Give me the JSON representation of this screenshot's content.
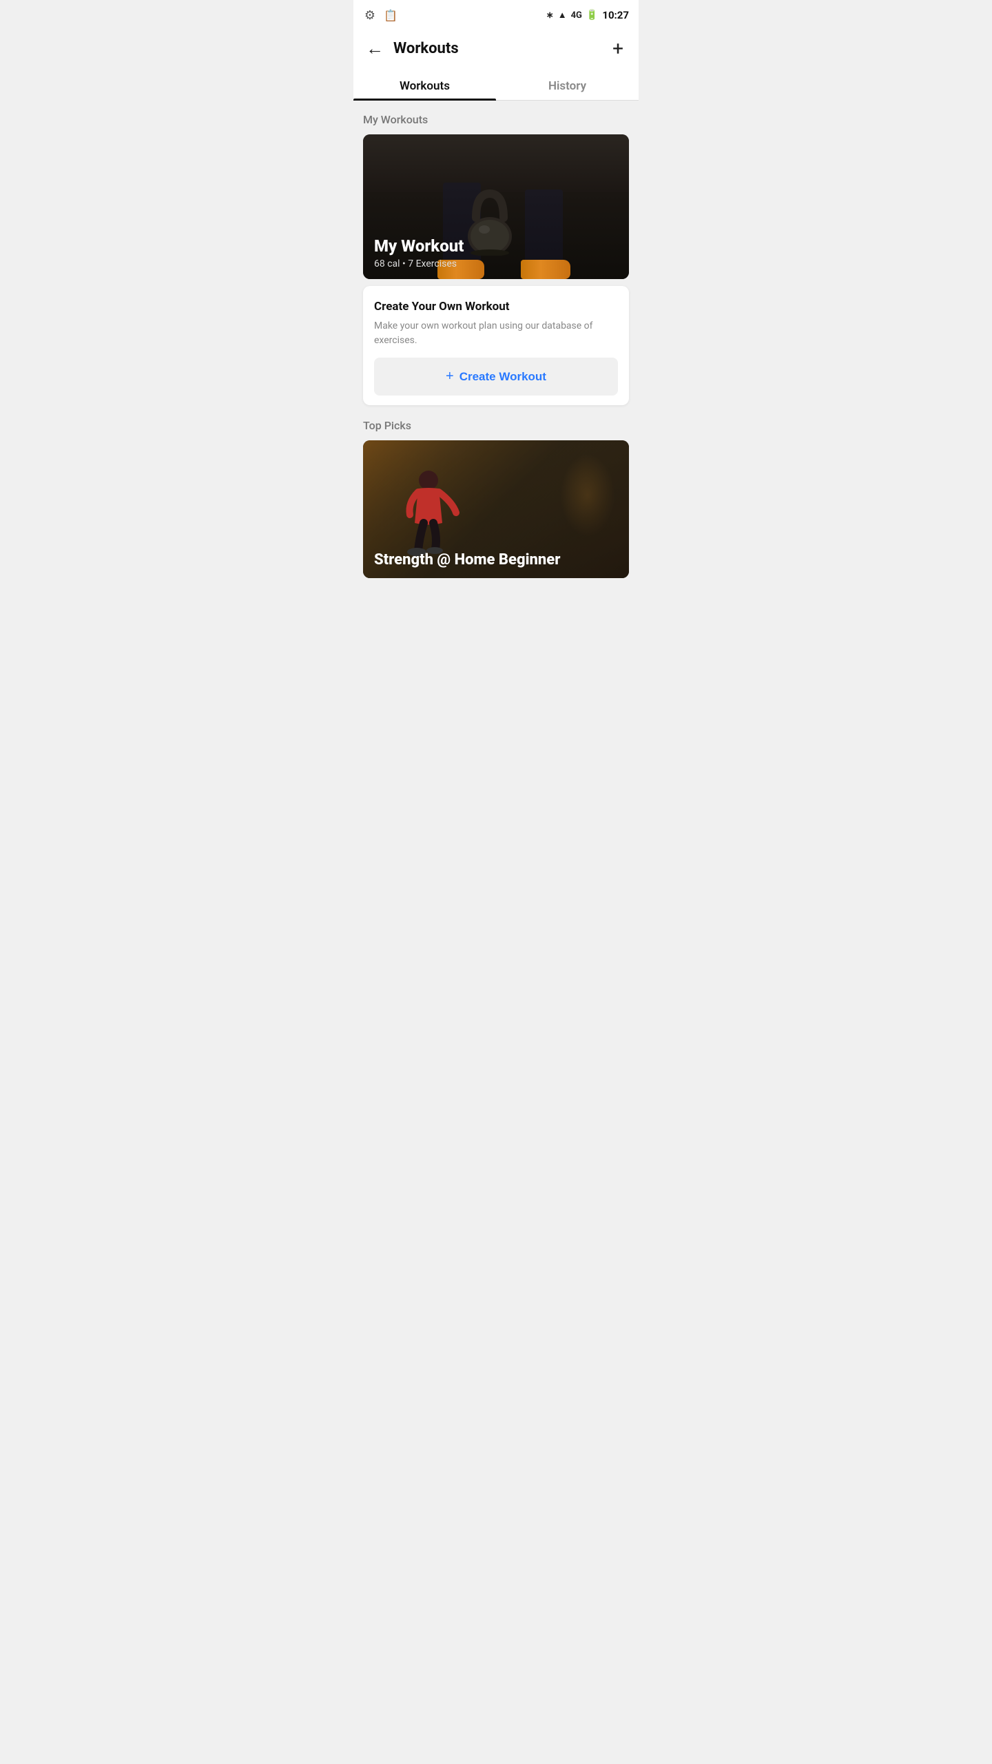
{
  "statusBar": {
    "time": "10:27",
    "network": "4G",
    "icons": {
      "bluetooth": "bluetooth-icon",
      "signal": "signal-icon",
      "battery": "battery-icon",
      "gear": "gear-icon",
      "clipboard": "clipboard-icon"
    }
  },
  "header": {
    "back_label": "←",
    "title": "Workouts",
    "add_label": "+"
  },
  "tabs": [
    {
      "id": "workouts",
      "label": "Workouts",
      "active": true
    },
    {
      "id": "history",
      "label": "History",
      "active": false
    }
  ],
  "myWorkouts": {
    "section_title": "My Workouts",
    "card": {
      "name": "My Workout",
      "calories": "68 cal",
      "exercises": "7 Exercises",
      "meta": "68 cal • 7 Exercises"
    }
  },
  "createWorkout": {
    "title": "Create Your Own Workout",
    "description": "Make your own workout plan using our database of exercises.",
    "button_label": "+ Create Workout",
    "button_plus": "+",
    "button_text": "Create Workout"
  },
  "topPicks": {
    "section_title": "Top Picks",
    "card": {
      "name": "Strength @ Home Beginner"
    }
  }
}
